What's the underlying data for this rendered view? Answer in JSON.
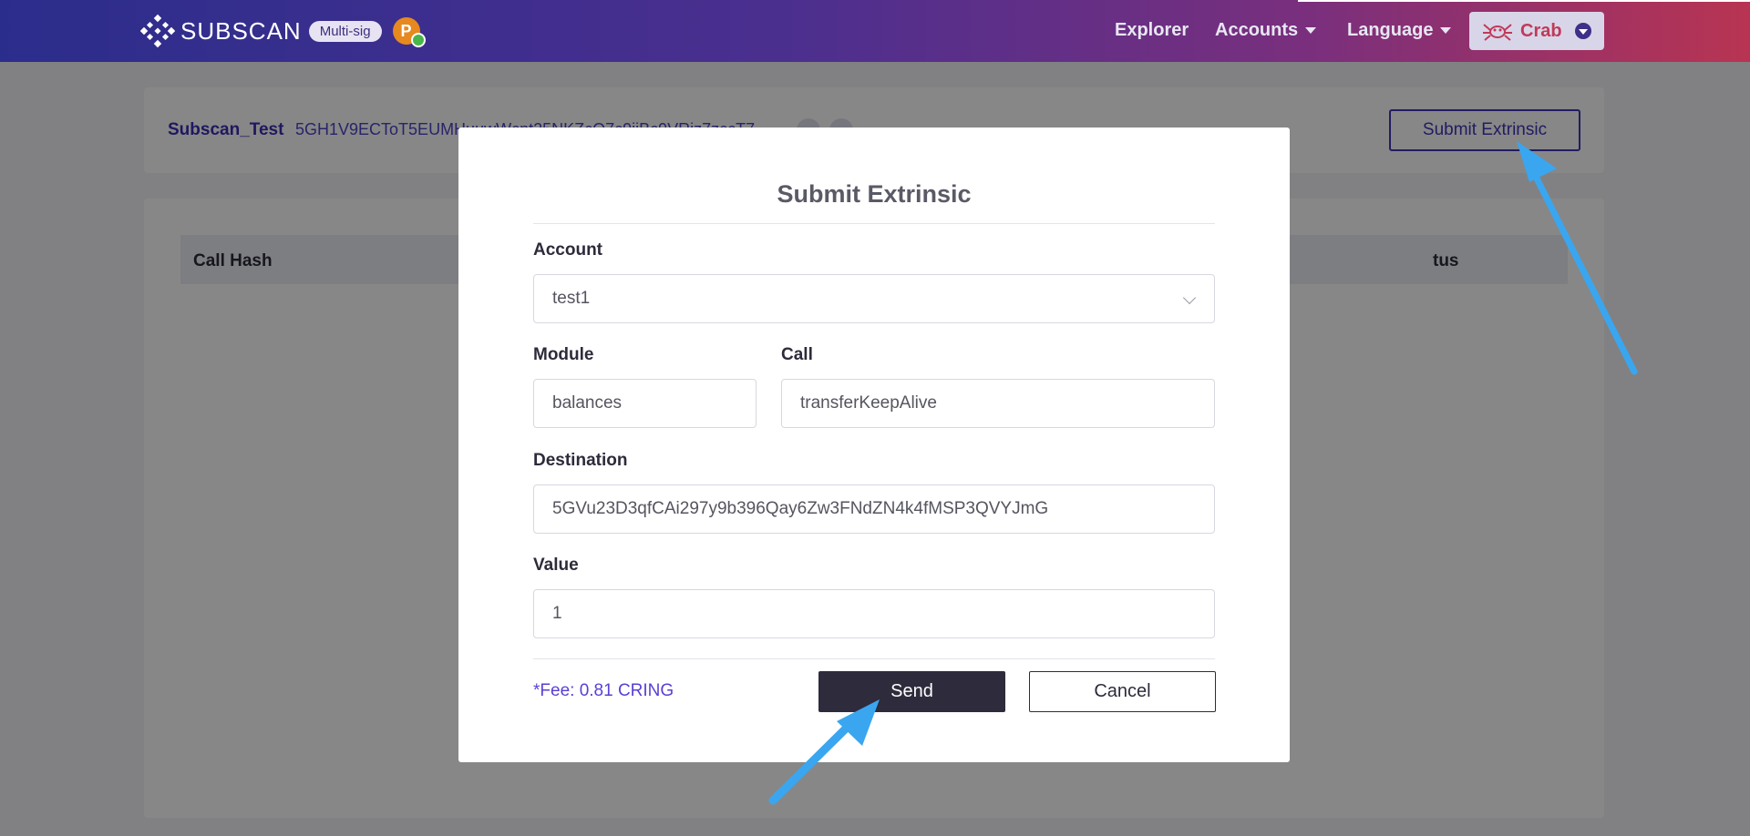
{
  "header": {
    "logo_text": "SUBSCAN",
    "badge": "Multi-sig",
    "polka_letter": "P",
    "nav": {
      "explorer": "Explorer",
      "accounts": "Accounts",
      "language": "Language"
    },
    "network": "Crab"
  },
  "page": {
    "account_name": "Subscan_Test",
    "account_address": "5GH1V9ECToT5EUMHuuwWcnt25NKZcQ7c9jjBc9VRjz7zccT7",
    "submit_button": "Submit Extrinsic",
    "table_headers": {
      "call_hash": "Call Hash",
      "status_partial": "tus"
    }
  },
  "modal": {
    "title": "Submit Extrinsic",
    "account_label": "Account",
    "account_value": "test1",
    "module_label": "Module",
    "module_value": "balances",
    "call_label": "Call",
    "call_value": "transferKeepAlive",
    "destination_label": "Destination",
    "destination_value": "5GVu23D3qfCAi297y9b396Qay6Zw3FNdZN4k4fMSP3QVYJmG",
    "value_label": "Value",
    "value_value": "1",
    "fee": "*Fee: 0.81 CRING",
    "send": "Send",
    "cancel": "Cancel"
  },
  "colors": {
    "accent": "#3f35b7",
    "annotation_arrow": "#3aa6f0",
    "network": "#c03a58"
  },
  "icons": [
    "subscan-logo-icon",
    "polkadot-icon",
    "verified-check-icon",
    "caret-down-icon",
    "crab-icon",
    "copy-icon",
    "qr-icon",
    "chevron-down-icon",
    "annotation-arrow-icon"
  ]
}
